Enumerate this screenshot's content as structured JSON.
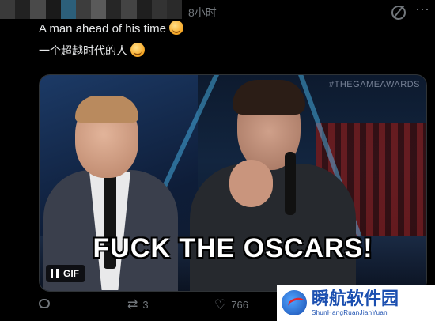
{
  "header": {
    "timestamp": "8小时"
  },
  "post": {
    "text_en": "A man ahead of his time",
    "text_cn": "一个超越时代的人",
    "emoji": "smiling-face-emoji"
  },
  "media": {
    "watermark": "#THEGAMEAWARDS",
    "caption": "FUCK THE OSCARS!",
    "gif_label": "GIF"
  },
  "actions": {
    "retweet_count": "3",
    "like_count": "766"
  },
  "site_logo": {
    "name_cn": "瞬航软件园",
    "name_en": "ShunHangRuanJianYuan"
  },
  "colors": {
    "background": "#000000",
    "text": "#e7e9ea",
    "muted": "#71767b",
    "logo_blue": "#1b4fb0"
  }
}
